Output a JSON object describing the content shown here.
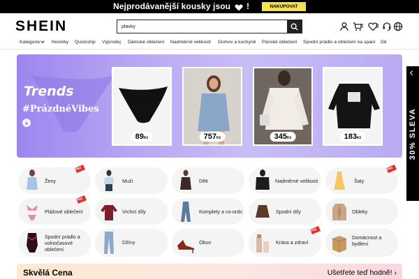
{
  "promo": {
    "text_before": "Nejprodávanější kousky jsou",
    "text_after": "!",
    "button": "NAKUPOVAT"
  },
  "header": {
    "logo": "SHEIN",
    "search_value": "plavky",
    "cart_count": "0",
    "wishlist_count": "0"
  },
  "nav": {
    "items": [
      "Kategorie",
      "Novinky",
      "Quickship",
      "Výprodej",
      "Dámské oblečení",
      "Nadměrné velikosti",
      "Domov a kuchyně",
      "Pánské oblečení",
      "Spodní prádlo a oblečení na spaní",
      "Dě"
    ]
  },
  "banner": {
    "title": "Trends",
    "hashtag": "#PrázdnéVibes",
    "products": [
      {
        "price": "89",
        "currency": "Kč"
      },
      {
        "price": "757",
        "currency": "Kč"
      },
      {
        "price": "345",
        "currency": "Kč"
      },
      {
        "price": "183",
        "currency": "Kč"
      }
    ]
  },
  "side_tab": {
    "text": "30% SLEVA"
  },
  "categories": [
    {
      "label": "Ženy",
      "hot": "Hot"
    },
    {
      "label": "Muži"
    },
    {
      "label": "Děti"
    },
    {
      "label": "Nadměrné velikosti"
    },
    {
      "label": "Šaty",
      "hot": "Hot"
    },
    {
      "label": "Plážové oblečení",
      "hot": "Hot"
    },
    {
      "label": "Vrchní díly"
    },
    {
      "label": "Komplety a co-ords"
    },
    {
      "label": "Spodní díly"
    },
    {
      "label": "Obleky"
    },
    {
      "label": "Spodní prádlo a volnočasové oblečení"
    },
    {
      "label": "Džíny"
    },
    {
      "label": "Obuv"
    },
    {
      "label": "Krása a zdraví",
      "hot": "Hot"
    },
    {
      "label": "Domácnost a bydlení"
    }
  ],
  "strip": {
    "title": "Skvělá Cena",
    "link": "Ušetřete teď hodně!"
  },
  "colors": {
    "accent": "#f5e14b",
    "hot_badge": "#e3302f",
    "banner_purple": "#9c86ee"
  }
}
